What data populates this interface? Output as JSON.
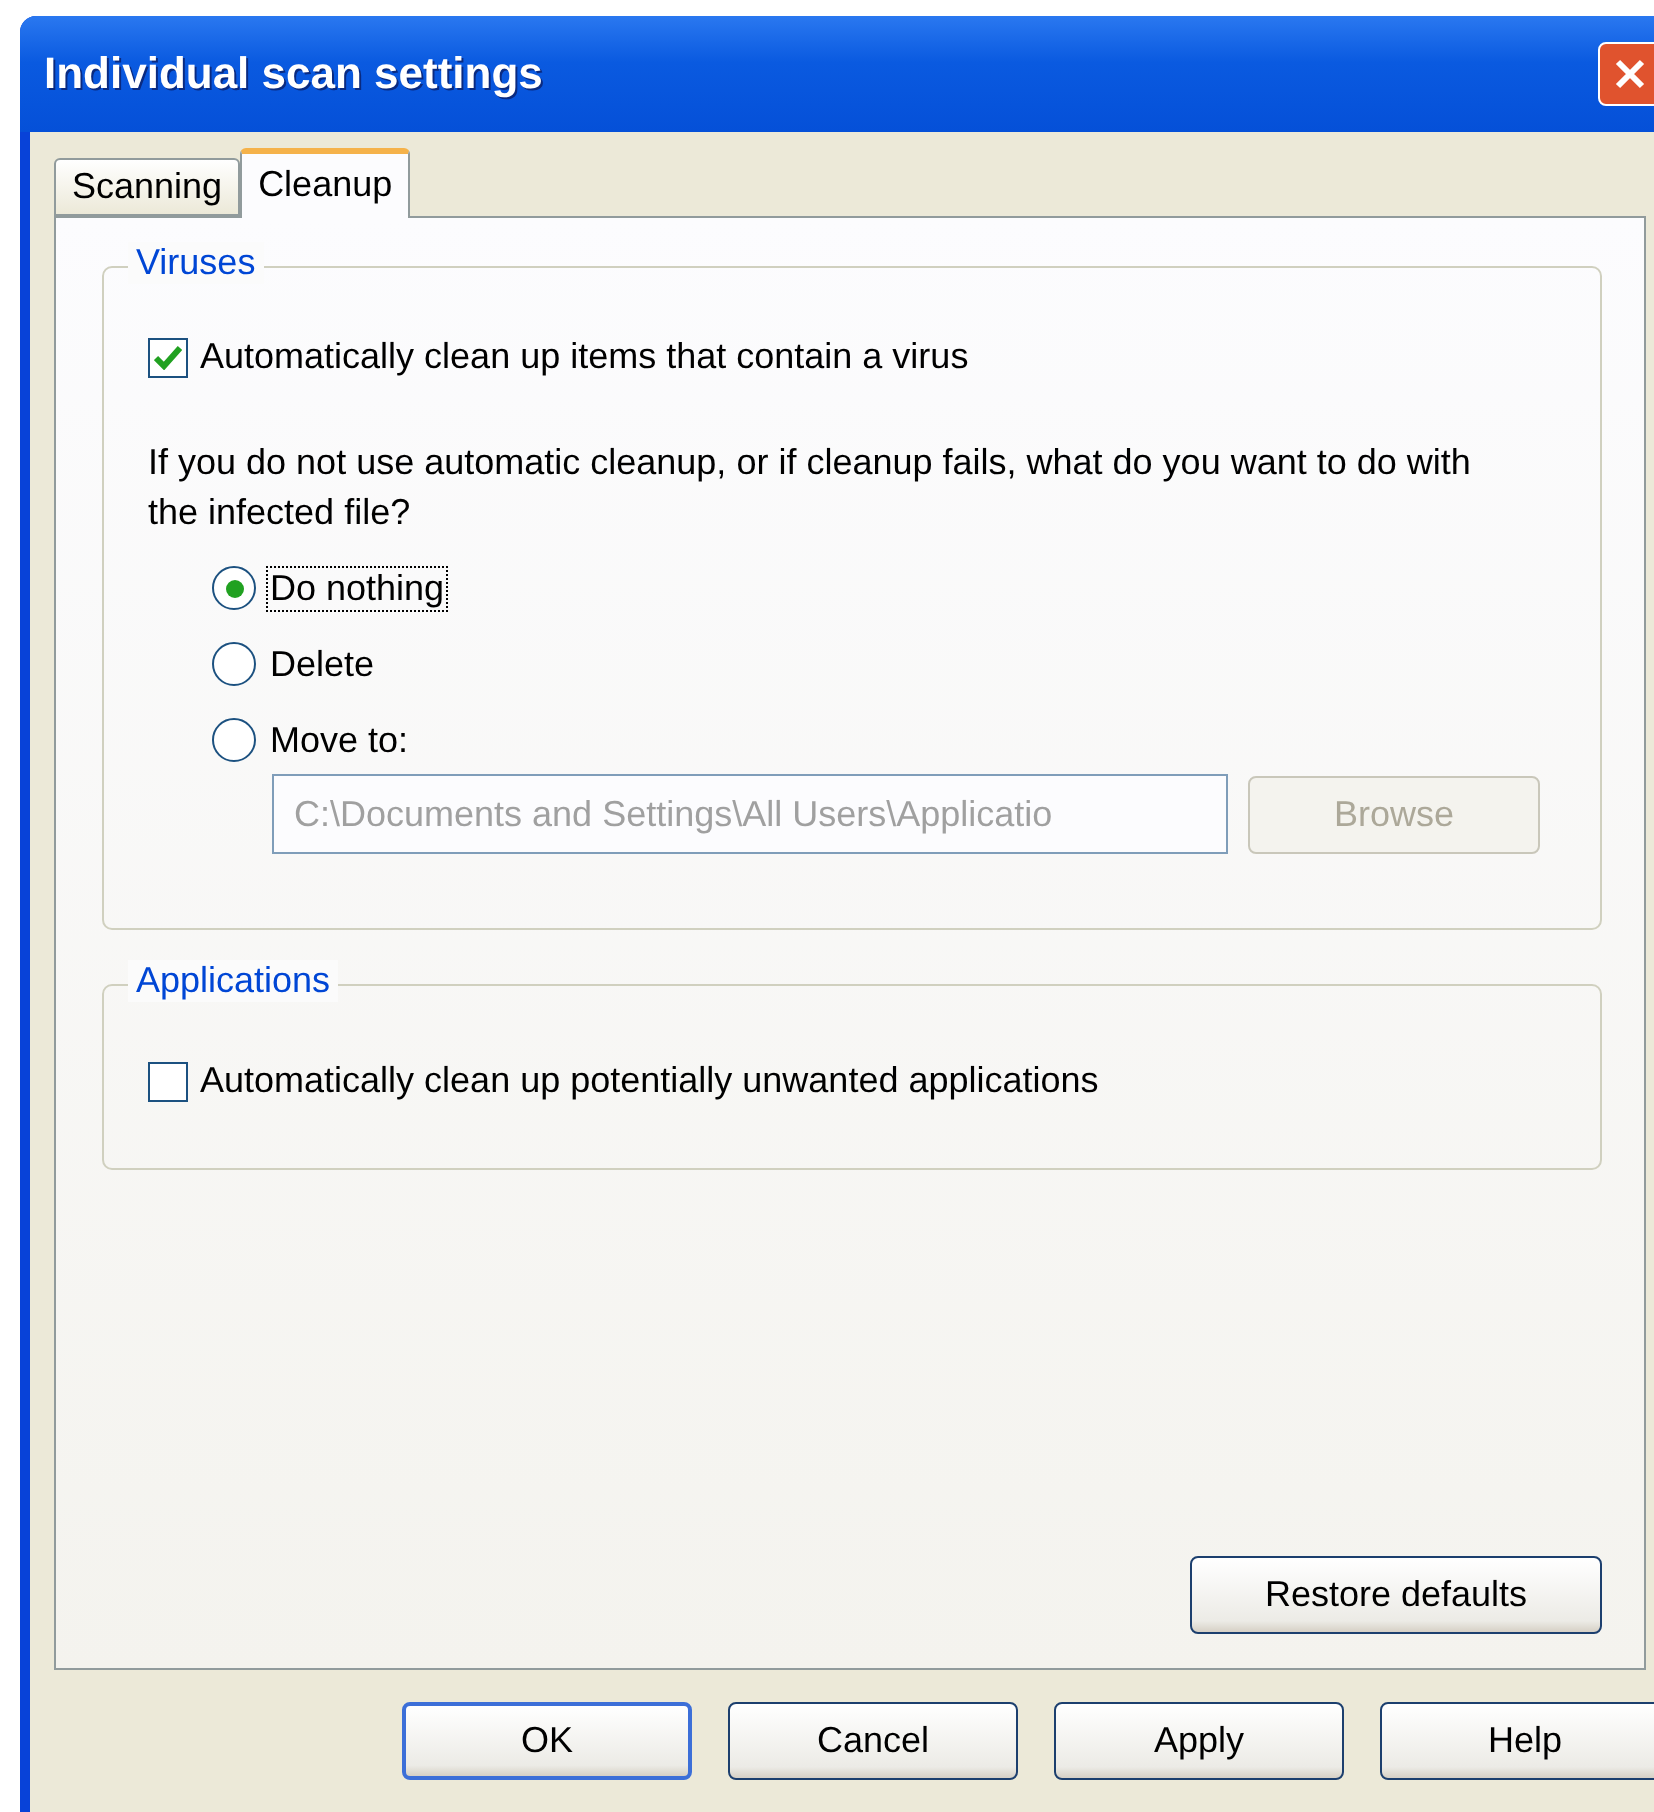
{
  "window": {
    "title": "Individual scan settings"
  },
  "tabs": [
    {
      "label": "Scanning",
      "selected": false
    },
    {
      "label": "Cleanup",
      "selected": true
    }
  ],
  "viruses": {
    "title": "Viruses",
    "auto_clean": {
      "label": "Automatically clean up items that contain a virus",
      "checked": true
    },
    "question": "If you do not use automatic cleanup, or if cleanup fails, what do you want to do with the infected file?",
    "options": [
      {
        "label": "Do nothing",
        "selected": true,
        "focused": true
      },
      {
        "label": "Delete",
        "selected": false,
        "focused": false
      },
      {
        "label": "Move to:",
        "selected": false,
        "focused": false
      }
    ],
    "move_path": {
      "value": "C:\\Documents and Settings\\All Users\\Applicatio",
      "disabled": true
    },
    "browse": {
      "label": "Browse",
      "disabled": true
    }
  },
  "applications": {
    "title": "Applications",
    "auto_clean": {
      "label": "Automatically clean up potentially unwanted applications",
      "checked": false
    }
  },
  "restore_button": "Restore defaults",
  "buttons": [
    {
      "label": "OK",
      "default": true
    },
    {
      "label": "Cancel",
      "default": false
    },
    {
      "label": "Apply",
      "default": false
    },
    {
      "label": "Help",
      "default": false
    }
  ]
}
